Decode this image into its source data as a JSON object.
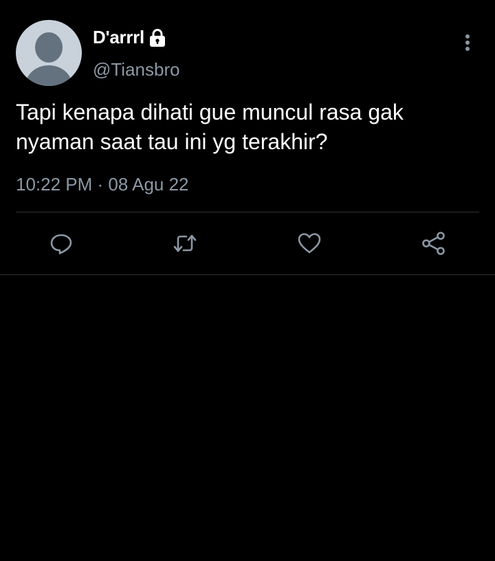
{
  "tweet": {
    "author": {
      "display_name": "D'arrrl",
      "handle": "@Tiansbro",
      "protected_icon": "lock-icon",
      "avatar_icon": "default-avatar-icon"
    },
    "text": "Tapi kenapa dihati gue muncul rasa gak\nnyaman saat tau ini yg terakhir?",
    "timestamp": "10:22 PM · 08 Agu 22",
    "menu_icon": "more-vertical-icon",
    "actions": [
      {
        "name": "reply",
        "icon": "reply-icon"
      },
      {
        "name": "retweet",
        "icon": "retweet-icon"
      },
      {
        "name": "like",
        "icon": "heart-icon"
      },
      {
        "name": "share",
        "icon": "share-icon"
      }
    ]
  },
  "colors": {
    "background": "#000000",
    "primary_text": "#ffffff",
    "secondary_text": "#8b98a5",
    "divider": "#2f3336",
    "avatar_bg": "#c9d1da",
    "avatar_fg": "#647280"
  }
}
